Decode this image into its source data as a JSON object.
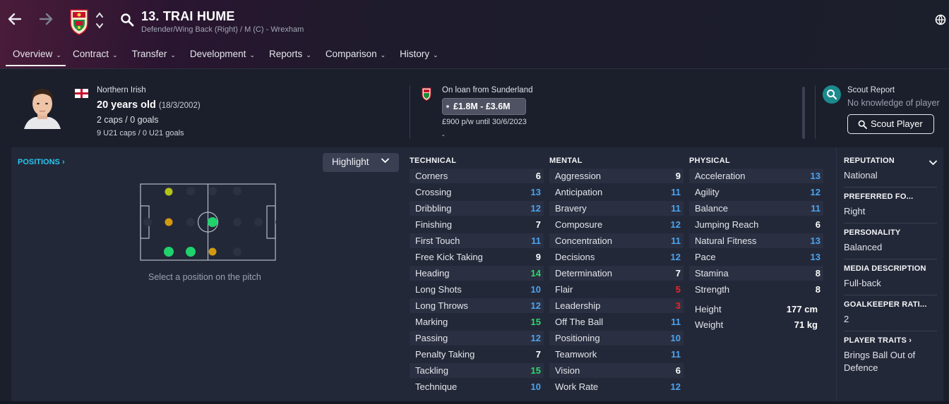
{
  "header": {
    "title": "13. TRAI HUME",
    "subtitle": "Defender/Wing Back (Right) / M (C) - Wrexham"
  },
  "tabs": [
    {
      "label": "Overview"
    },
    {
      "label": "Contract"
    },
    {
      "label": "Transfer"
    },
    {
      "label": "Development"
    },
    {
      "label": "Reports"
    },
    {
      "label": "Comparison"
    },
    {
      "label": "History"
    }
  ],
  "player": {
    "nationality": "Northern Irish",
    "age": "20 years old",
    "dob": "(18/3/2002)",
    "caps": "2 caps / 0 goals",
    "u21": "9 U21 caps / 0 U21 goals"
  },
  "contract": {
    "loan": "On loan from Sunderland",
    "value": "£1.8M - £3.6M",
    "wage": "£900 p/w until 30/6/2023",
    "extra": "-"
  },
  "scout": {
    "title": "Scout Report",
    "subtitle": "No knowledge of player",
    "button": "Scout Player"
  },
  "positions": {
    "link": "POSITIONS",
    "highlight": "Highlight",
    "caption": "Select a position on the pitch"
  },
  "technical": {
    "title": "TECHNICAL",
    "attrs": [
      {
        "name": "Corners",
        "value": "6"
      },
      {
        "name": "Crossing",
        "value": "13"
      },
      {
        "name": "Dribbling",
        "value": "12"
      },
      {
        "name": "Finishing",
        "value": "7"
      },
      {
        "name": "First Touch",
        "value": "11"
      },
      {
        "name": "Free Kick Taking",
        "value": "9"
      },
      {
        "name": "Heading",
        "value": "14"
      },
      {
        "name": "Long Shots",
        "value": "10"
      },
      {
        "name": "Long Throws",
        "value": "12"
      },
      {
        "name": "Marking",
        "value": "15"
      },
      {
        "name": "Passing",
        "value": "12"
      },
      {
        "name": "Penalty Taking",
        "value": "7"
      },
      {
        "name": "Tackling",
        "value": "15"
      },
      {
        "name": "Technique",
        "value": "10"
      }
    ]
  },
  "mental": {
    "title": "MENTAL",
    "attrs": [
      {
        "name": "Aggression",
        "value": "9"
      },
      {
        "name": "Anticipation",
        "value": "11"
      },
      {
        "name": "Bravery",
        "value": "11"
      },
      {
        "name": "Composure",
        "value": "12"
      },
      {
        "name": "Concentration",
        "value": "11"
      },
      {
        "name": "Decisions",
        "value": "12"
      },
      {
        "name": "Determination",
        "value": "7"
      },
      {
        "name": "Flair",
        "value": "5"
      },
      {
        "name": "Leadership",
        "value": "3"
      },
      {
        "name": "Off The Ball",
        "value": "11"
      },
      {
        "name": "Positioning",
        "value": "10"
      },
      {
        "name": "Teamwork",
        "value": "11"
      },
      {
        "name": "Vision",
        "value": "6"
      },
      {
        "name": "Work Rate",
        "value": "12"
      }
    ]
  },
  "physical": {
    "title": "PHYSICAL",
    "attrs": [
      {
        "name": "Acceleration",
        "value": "13"
      },
      {
        "name": "Agility",
        "value": "12"
      },
      {
        "name": "Balance",
        "value": "11"
      },
      {
        "name": "Jumping Reach",
        "value": "6"
      },
      {
        "name": "Natural Fitness",
        "value": "13"
      },
      {
        "name": "Pace",
        "value": "13"
      },
      {
        "name": "Stamina",
        "value": "8"
      },
      {
        "name": "Strength",
        "value": "8"
      }
    ],
    "height_label": "Height",
    "height": "177 cm",
    "weight_label": "Weight",
    "weight": "71 kg"
  },
  "info": {
    "reputation_label": "REPUTATION",
    "reputation": "National",
    "foot_label": "PREFERRED FO...",
    "foot": "Right",
    "personality_label": "PERSONALITY",
    "personality": "Balanced",
    "media_label": "MEDIA DESCRIPTION",
    "media": "Full-back",
    "gk_label": "GOALKEEPER RATI...",
    "gk": "2",
    "traits_label": "PLAYER TRAITS",
    "traits": "Brings Ball Out of Defence"
  },
  "colors": {
    "high": "#2fd86a",
    "mid": "#4ba4f0",
    "low": "#ea2727",
    "normal": "#ffffff",
    "accent": "#27c6ef"
  },
  "icons": [
    "back-arrow-icon",
    "forward-arrow-icon",
    "club-crest-icon",
    "search-icon",
    "globe-icon",
    "scout-search-icon",
    "chevron-down-icon",
    "chevron-right-icon"
  ]
}
